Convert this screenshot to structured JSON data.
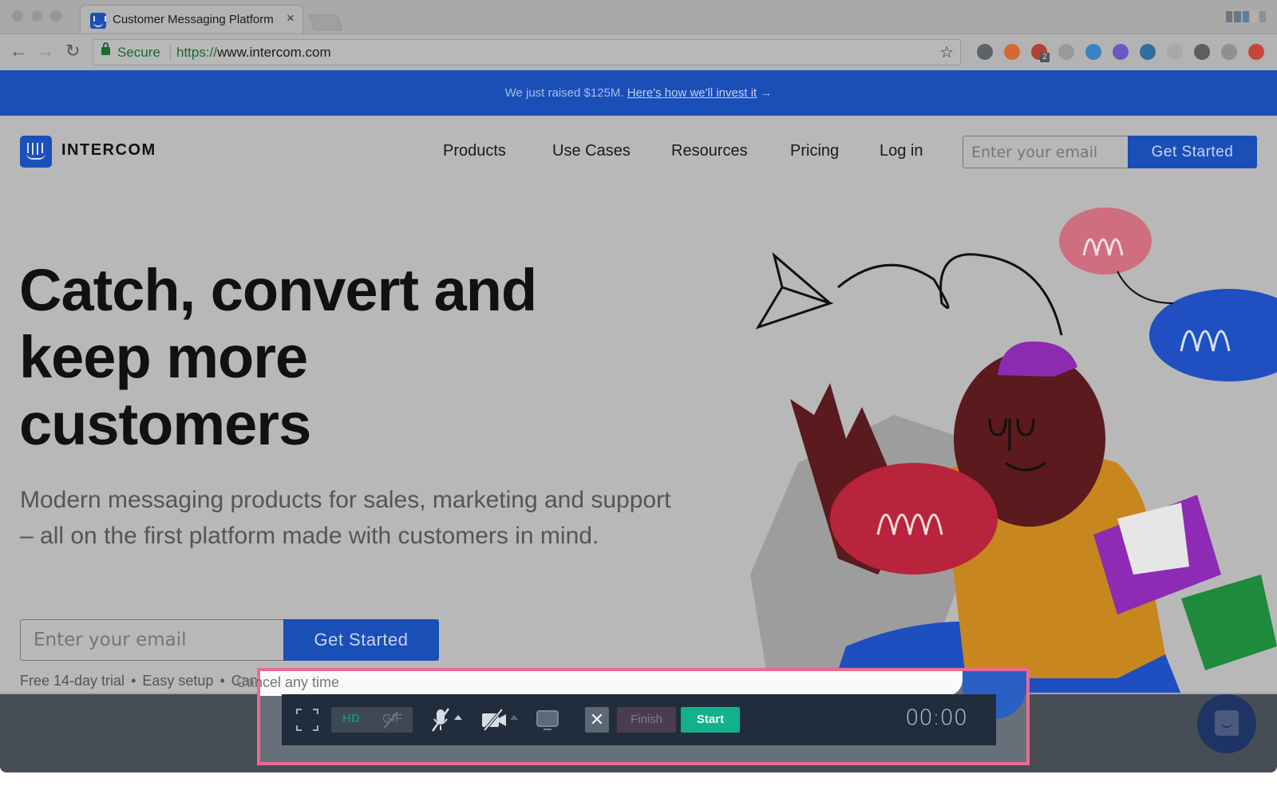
{
  "browser": {
    "tab_title": "Customer Messaging Platform",
    "tab_close": "×",
    "secure_label": "Secure",
    "url_scheme": "https://",
    "url_host": "www.intercom.com",
    "nav_icons": [
      "back-arrow-icon",
      "forward-arrow-icon",
      "reload-icon"
    ],
    "nav_glyphs": [
      "←",
      "→",
      "↻"
    ],
    "star_glyph": "☆",
    "extensions": [
      {
        "name": "evernote-extension-icon",
        "color": "#5d6468"
      },
      {
        "name": "fox-extension-icon",
        "color": "#d46a32"
      },
      {
        "name": "adblock-extension-icon",
        "color": "#b04138",
        "badge": "2"
      },
      {
        "name": "cloud-extension-icon",
        "color": "#9a9a9a"
      },
      {
        "name": "zoom-extension-icon",
        "color": "#3b82c4"
      },
      {
        "name": "shield-extension-icon",
        "color": "#6d57c4"
      },
      {
        "name": "compass-extension-icon",
        "color": "#2f6fa0"
      },
      {
        "name": "grid-extension-icon",
        "color": "#a8a8a8"
      },
      {
        "name": "spiral-extension-icon",
        "color": "#5e5e5e"
      },
      {
        "name": "square-extension-icon",
        "color": "#8f8f8f"
      },
      {
        "name": "upload-extension-icon",
        "color": "#c4473a"
      }
    ]
  },
  "announcement": {
    "text": "We just raised $125M.",
    "link": "Here's how we'll invest it",
    "arrow": "→"
  },
  "header": {
    "brand": "INTERCOM",
    "nav": [
      "Products",
      "Use Cases",
      "Resources",
      "Pricing",
      "Log in"
    ],
    "email_placeholder": "Enter your email",
    "cta": "Get Started"
  },
  "hero": {
    "title_lines": [
      "Catch, convert and",
      "keep more",
      "customers"
    ],
    "subtitle": "Modern messaging products for sales, marketing and support – all on the first platform made with customers in mind.",
    "email_placeholder": "Enter your email",
    "cta": "Get Started",
    "notes": [
      "Free 14-day trial",
      "Easy setup",
      "Cancel any time"
    ],
    "note_separator": "•"
  },
  "recorder": {
    "quality_options": [
      "HD",
      "GIF"
    ],
    "selected_quality": "HD",
    "mic_muted": true,
    "camera_off": true,
    "cancel_glyph": "✕",
    "finish_label": "Finish",
    "start_label": "Start",
    "timer": "00:00"
  },
  "colors": {
    "brand_blue": "#1a4fb8",
    "start_green": "#13b08c",
    "highlight_pink": "#ea6b93"
  }
}
